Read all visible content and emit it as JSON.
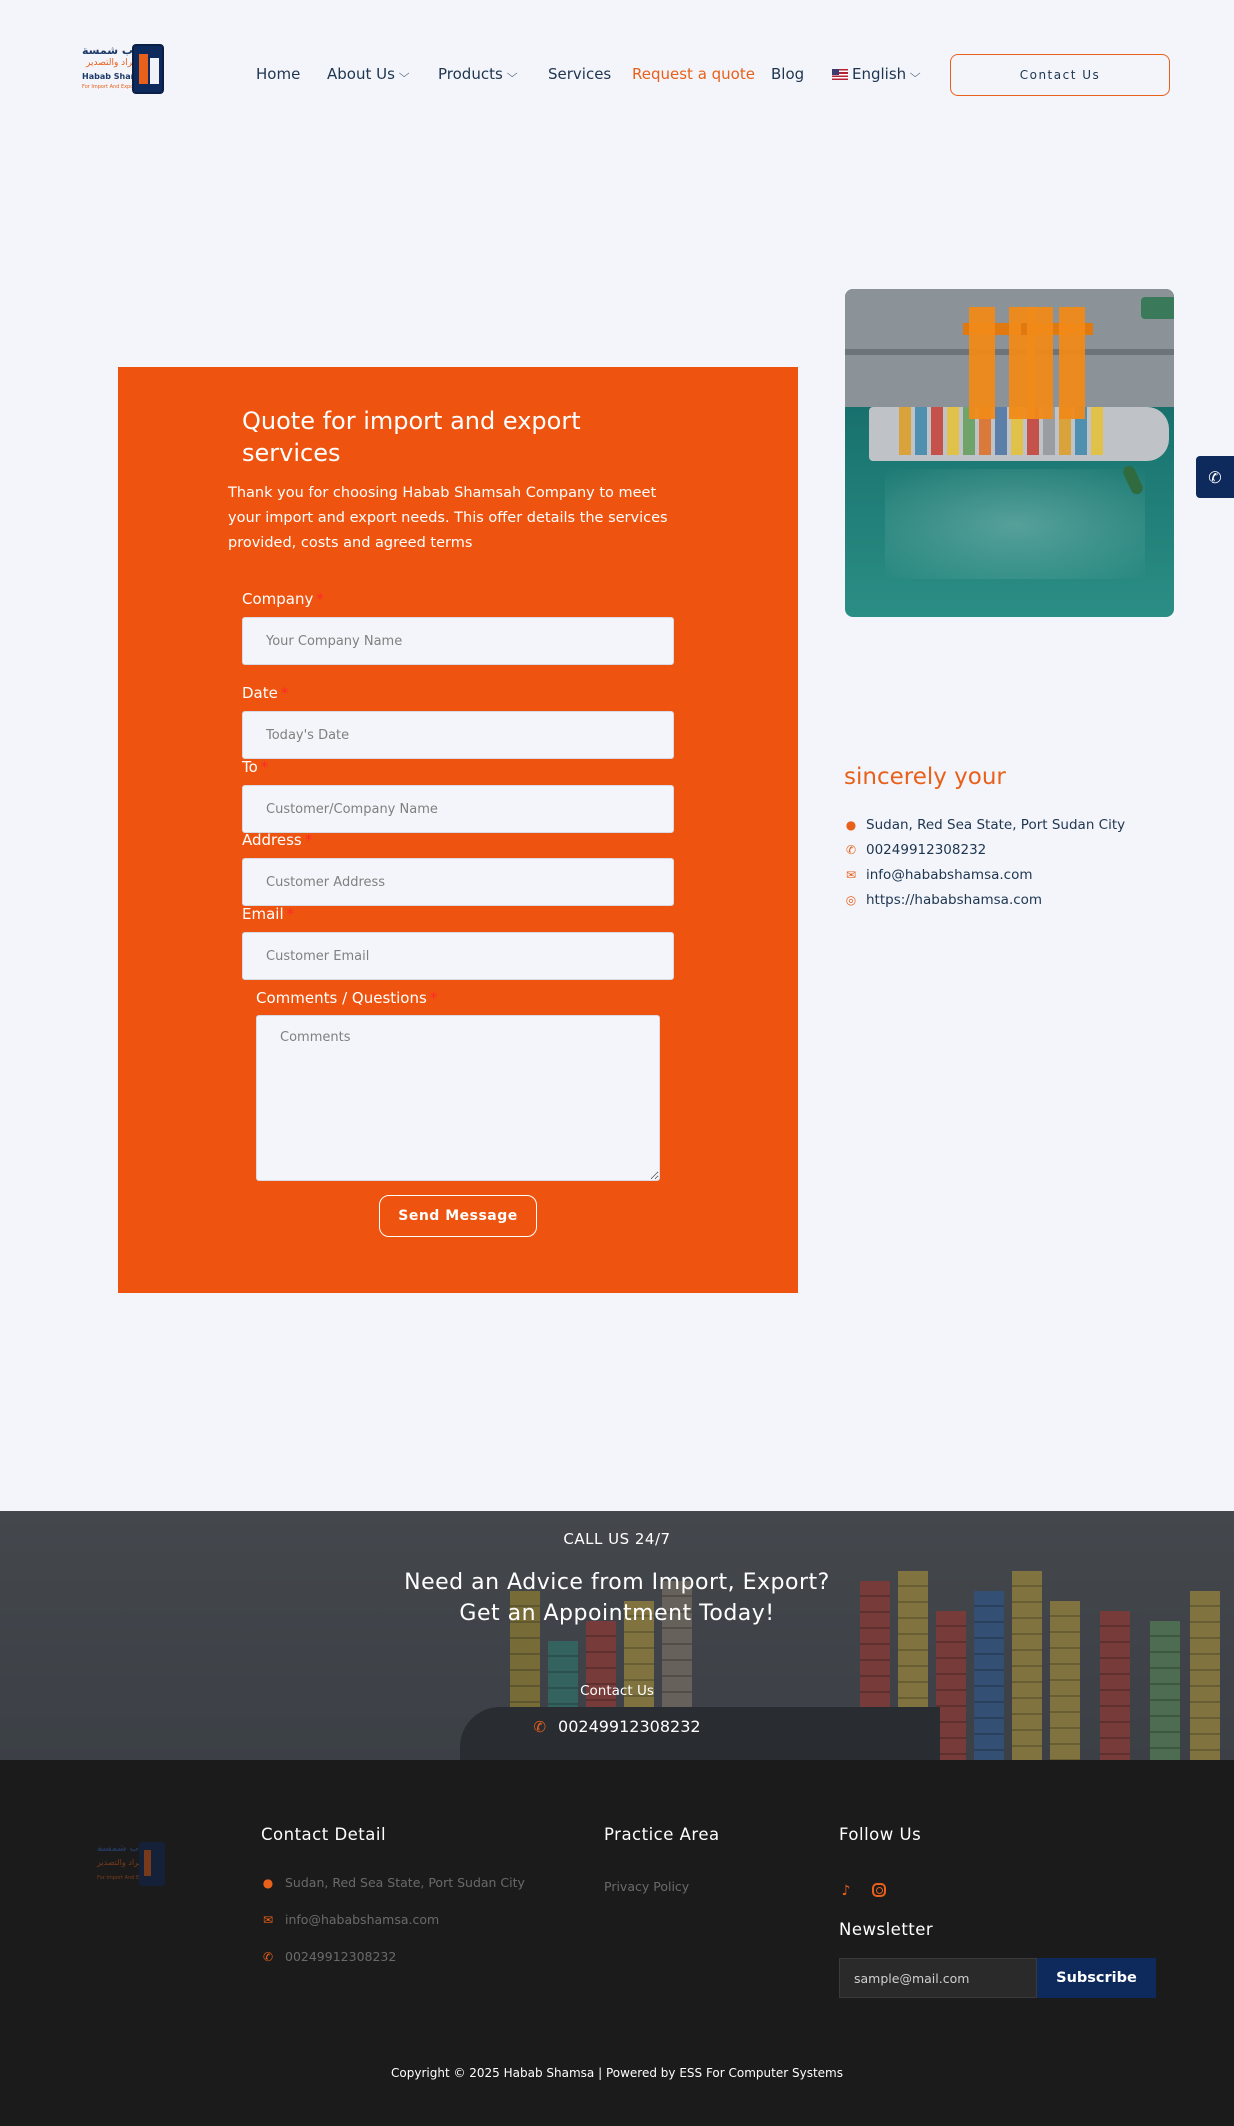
{
  "brand": {
    "logo_arabic_line1": "حباب شمسة",
    "logo_arabic_line2": "للإستيراد والتصدير",
    "logo_english": "Habab Shamsa",
    "logo_tagline": "For Import And Export"
  },
  "nav": {
    "home": "Home",
    "about": "About Us",
    "products": "Products",
    "services": "Services",
    "quote": "Request a quote",
    "blog": "Blog",
    "language": "English",
    "contact_button": "Contact Us"
  },
  "form": {
    "title": "Quote for import and export services",
    "intro": "Thank you for choosing Habab Shamsah Company to meet your import and export needs. This offer details the services provided, costs and agreed terms",
    "required_mark": "*",
    "fields": {
      "company": {
        "label": "Company",
        "placeholder": "Your Company Name"
      },
      "date": {
        "label": "Date",
        "placeholder": "Today's Date"
      },
      "to": {
        "label": "To",
        "placeholder": "Customer/Company Name"
      },
      "address": {
        "label": "Address",
        "placeholder": "Customer Address"
      },
      "email": {
        "label": "Email",
        "placeholder": "Customer Email"
      },
      "comments": {
        "label": "Comments / Questions",
        "placeholder": "Comments"
      }
    },
    "submit_label": "Send Message"
  },
  "contact_card": {
    "heading": "sincerely your",
    "address": "Sudan, Red Sea State, Port Sudan City",
    "phone": "00249912308232",
    "email": "info@hababshamsa.com",
    "website": "https://hababshamsa.com"
  },
  "banner": {
    "small": "CALL US 24/7",
    "headline_line1": "Need an Advice from Import, Export?",
    "headline_line2": "Get an Appointment Today!",
    "contact_label": "Contact Us",
    "phone": "00249912308232"
  },
  "footer": {
    "contact_heading": "Contact Detail",
    "address": "Sudan, Red Sea State, Port Sudan City",
    "email": "info@hababshamsa.com",
    "phone": "00249912308232",
    "practice_heading": "Practice Area",
    "privacy": "Privacy Policy",
    "follow_heading": "Follow Us",
    "newsletter_heading": "Newsletter",
    "newsletter_placeholder": "sample@mail.com",
    "subscribe_label": "Subscribe",
    "copyright": "Copyright © 2025 Habab Shamsa | Powered by ESS For Computer Systems"
  },
  "icons": {
    "phone": "phone-icon",
    "location": "location-pin-icon",
    "email": "envelope-icon",
    "globe": "globe-icon",
    "tiktok": "tiktok-icon",
    "instagram": "instagram-icon",
    "chevron": "chevron-down-icon"
  },
  "colors": {
    "accent": "#e8601a",
    "form_bg": "#ee540f",
    "navy": "#0e2a5c",
    "page_bg": "#f3f5fa",
    "footer_bg": "#1b1b1b"
  }
}
